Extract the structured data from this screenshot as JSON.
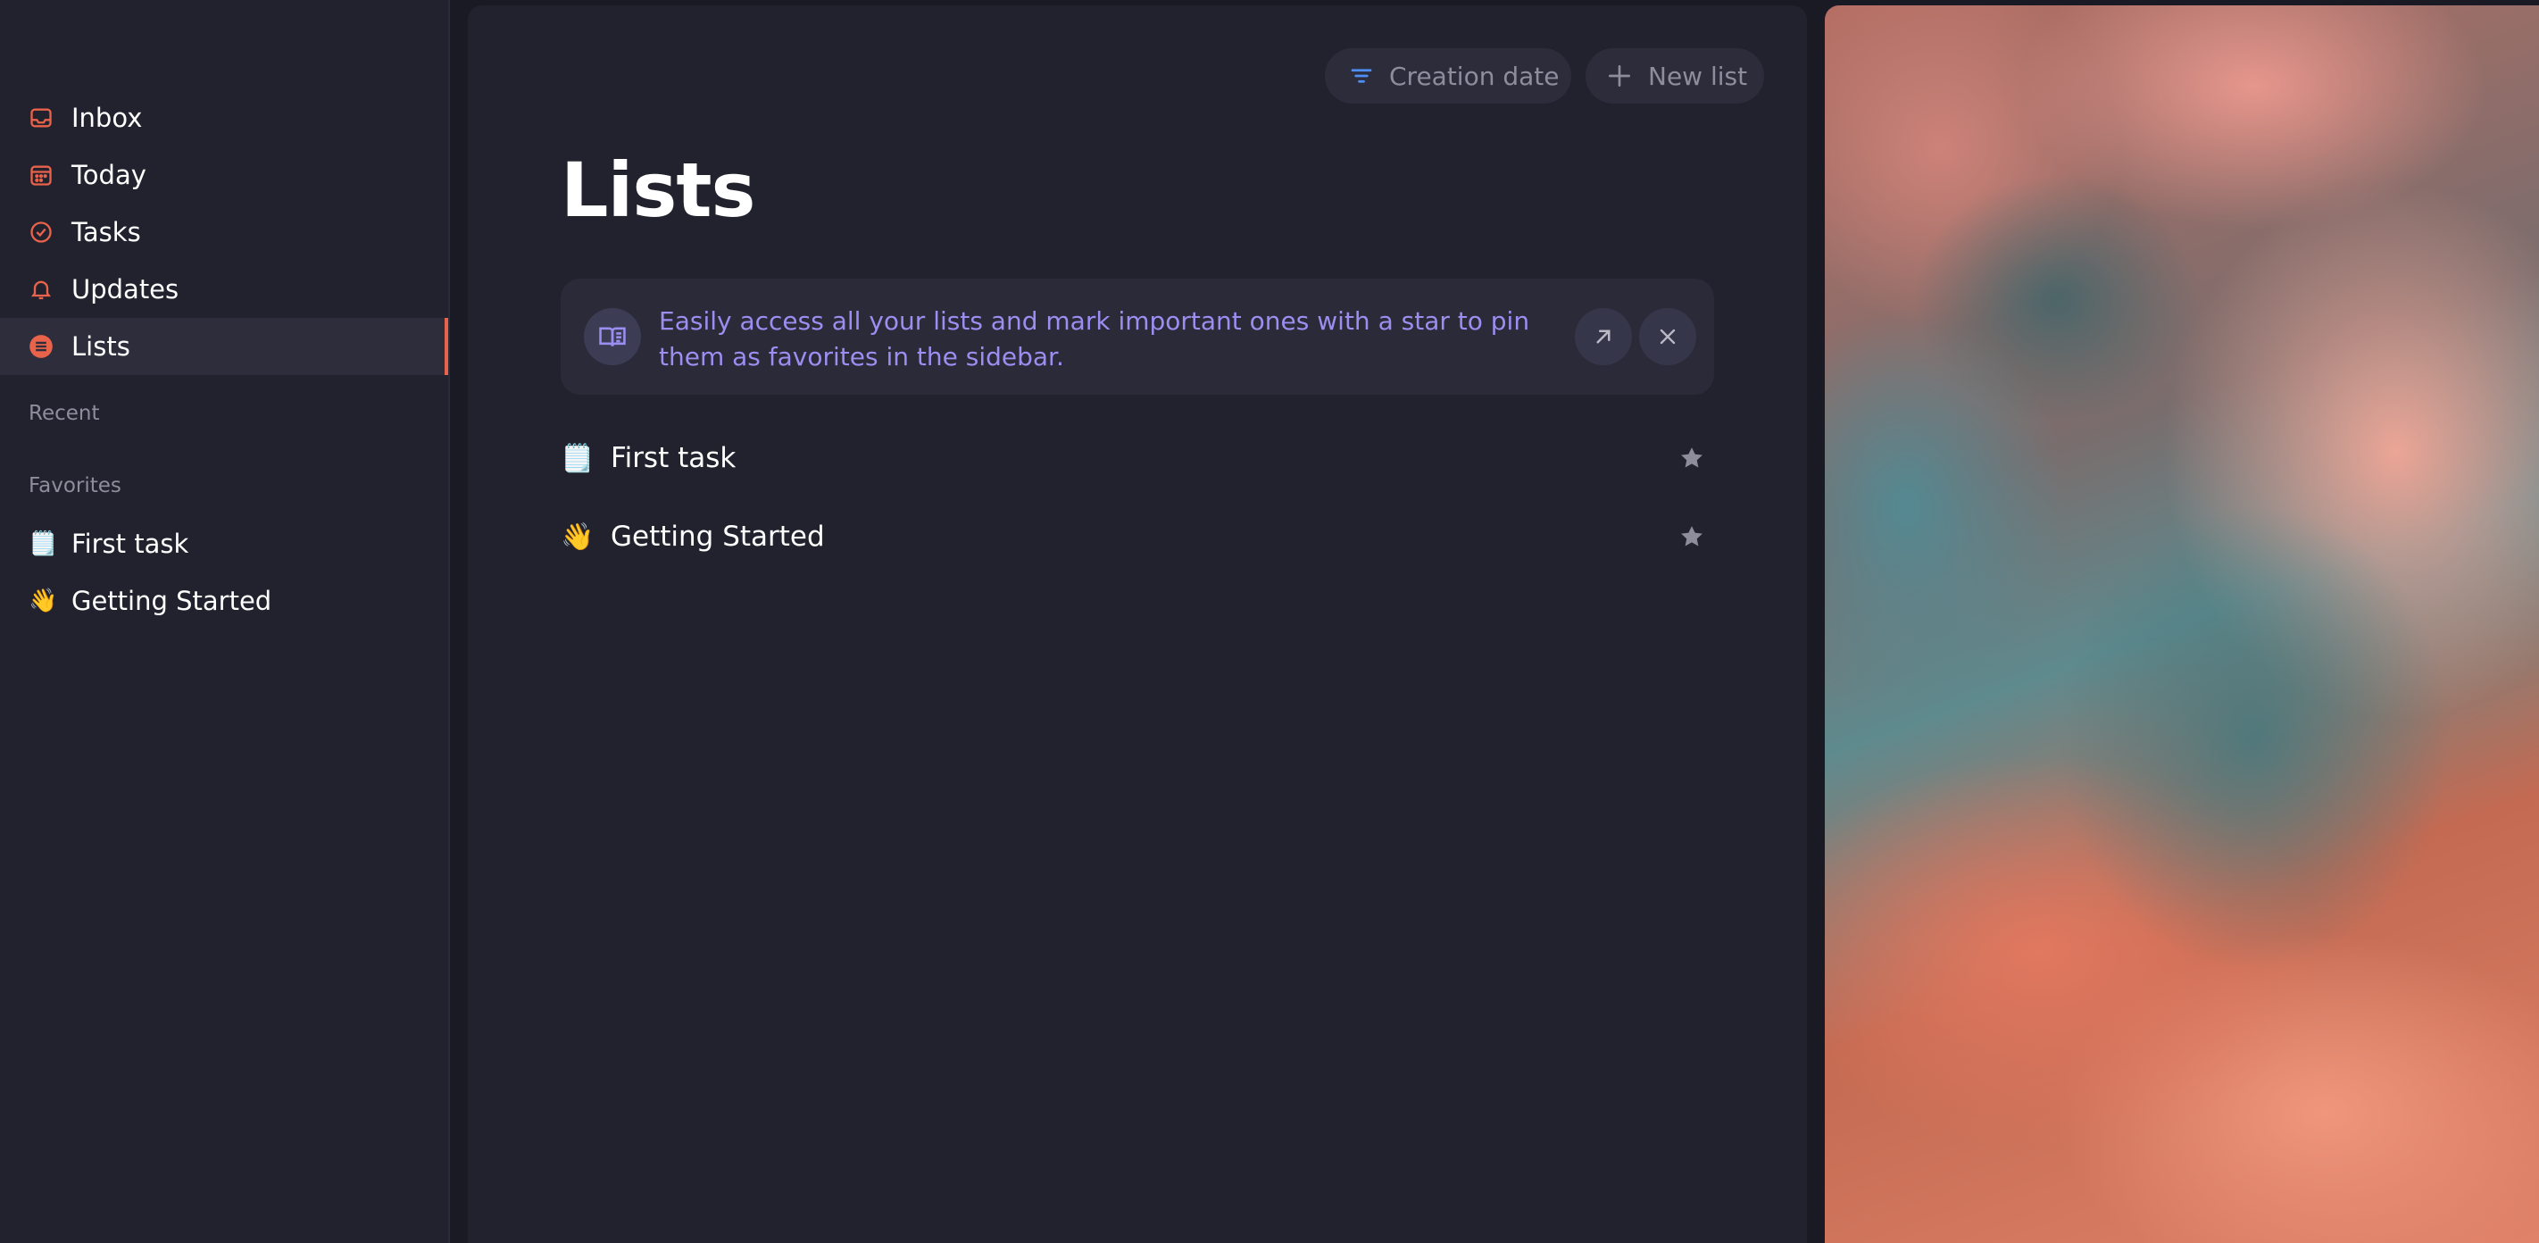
{
  "sidebar": {
    "nav": [
      {
        "label": "Inbox",
        "icon": "inbox-icon"
      },
      {
        "label": "Today",
        "icon": "calendar-icon"
      },
      {
        "label": "Tasks",
        "icon": "check-circle-icon"
      },
      {
        "label": "Updates",
        "icon": "bell-icon"
      },
      {
        "label": "Lists",
        "icon": "list-circle-icon",
        "active": true
      }
    ],
    "recent_label": "Recent",
    "favorites_label": "Favorites",
    "favorites": [
      {
        "emoji": "🗒️",
        "label": "First task"
      },
      {
        "emoji": "👋",
        "label": "Getting Started"
      }
    ]
  },
  "toolbar": {
    "sort_label": "Creation date",
    "new_list_label": "New list"
  },
  "main": {
    "title": "Lists",
    "banner_text": "Easily access all your lists and mark important ones with a star to pin them as favorites in the sidebar.",
    "lists": [
      {
        "emoji": "🗒️",
        "label": "First task"
      },
      {
        "emoji": "👋",
        "label": "Getting Started"
      }
    ]
  },
  "colors": {
    "accent": "#e8634a",
    "banner_text": "#9a8ff0",
    "background": "#22222f"
  }
}
